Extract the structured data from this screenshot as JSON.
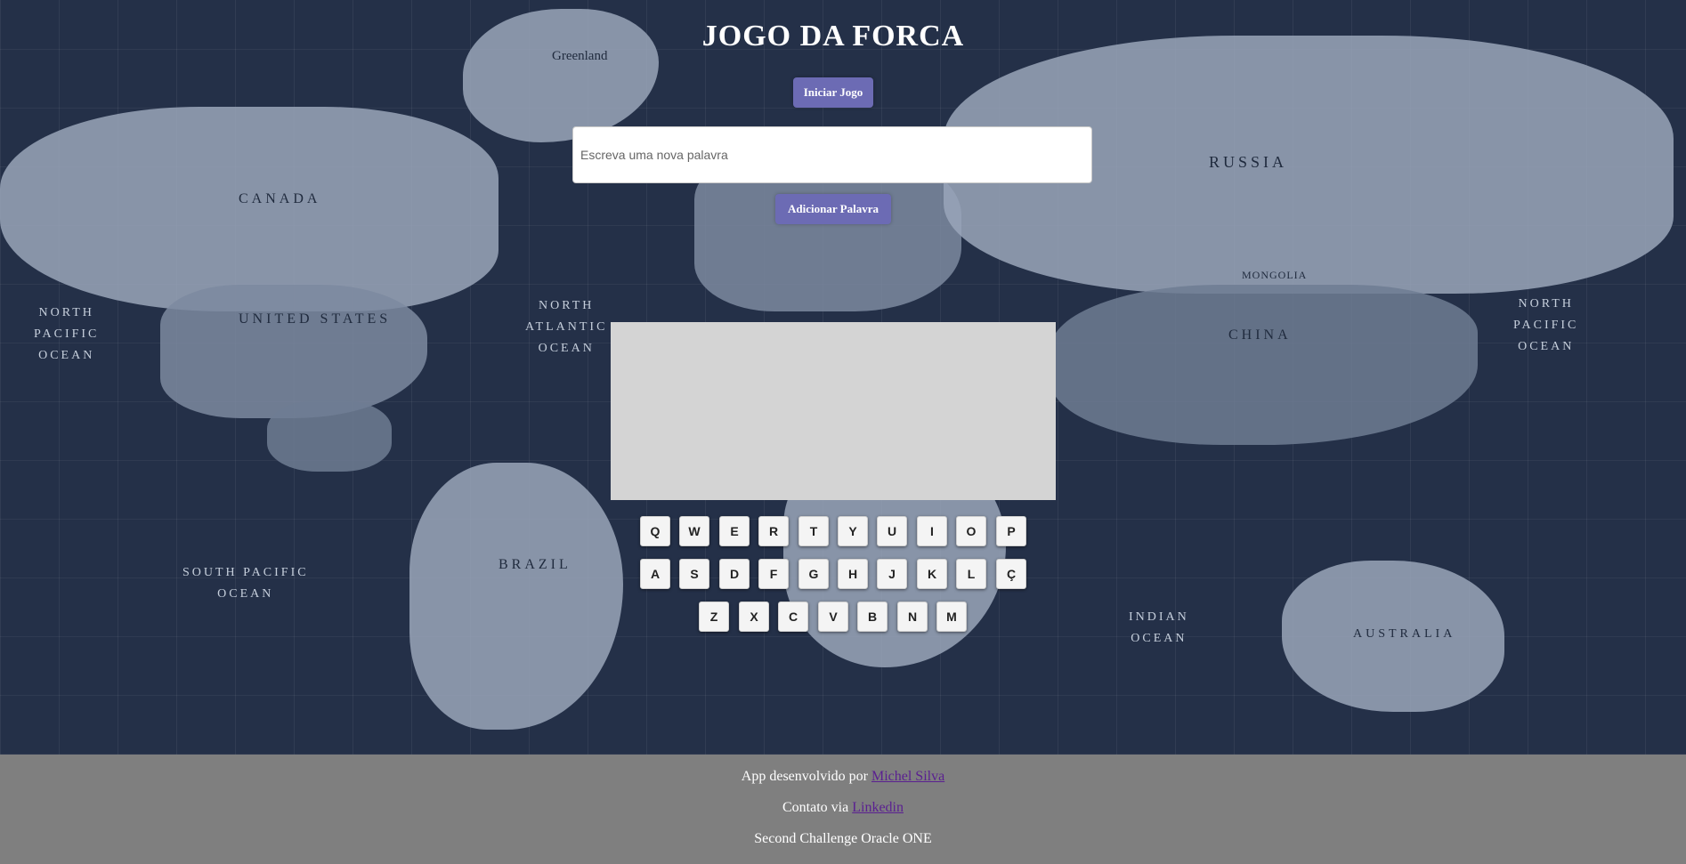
{
  "header": {
    "title": "JOGO DA FORCA"
  },
  "controls": {
    "start_button": "Iniciar Jogo",
    "new_word_placeholder": "Escreva uma nova palavra",
    "add_word_button": "Adicionar Palavra"
  },
  "keyboard": {
    "rows": [
      [
        "Q",
        "W",
        "E",
        "R",
        "T",
        "Y",
        "U",
        "I",
        "O",
        "P"
      ],
      [
        "A",
        "S",
        "D",
        "F",
        "G",
        "H",
        "J",
        "K",
        "L",
        "Ç"
      ],
      [
        "Z",
        "X",
        "C",
        "V",
        "B",
        "N",
        "M"
      ]
    ]
  },
  "map_labels": {
    "greenland": "Greenland",
    "canada": "CANADA",
    "united_states": "UNITED STATES",
    "russia": "RUSSIA",
    "china": "CHINA",
    "mongolia": "MONGOLIA",
    "brazil": "BRAZIL",
    "australia": "AUSTRALIA",
    "north_pacific_left": "NORTH\nPACIFIC\nOCEAN",
    "north_pacific_right": "NORTH\nPACIFIC\nOCEAN",
    "north_atlantic": "NORTH\nATLANTIC\nOCEAN",
    "south_pacific": "SOUTH PACIFIC\nOCEAN",
    "indian_ocean": "INDIAN\nOCEAN"
  },
  "footer": {
    "line1_prefix": "App desenvolvido por",
    "line1_link": "Michel Silva",
    "line2_prefix": "Contato via",
    "line2_link": "Linkedin",
    "line3": "Second Challenge Oracle ONE"
  },
  "colors": {
    "accent": "#6c6bb4",
    "background": "#26324a",
    "footer_bg": "#7f7f7f",
    "canvas_bg": "#d4d4d4",
    "link": "#5a1f91"
  }
}
